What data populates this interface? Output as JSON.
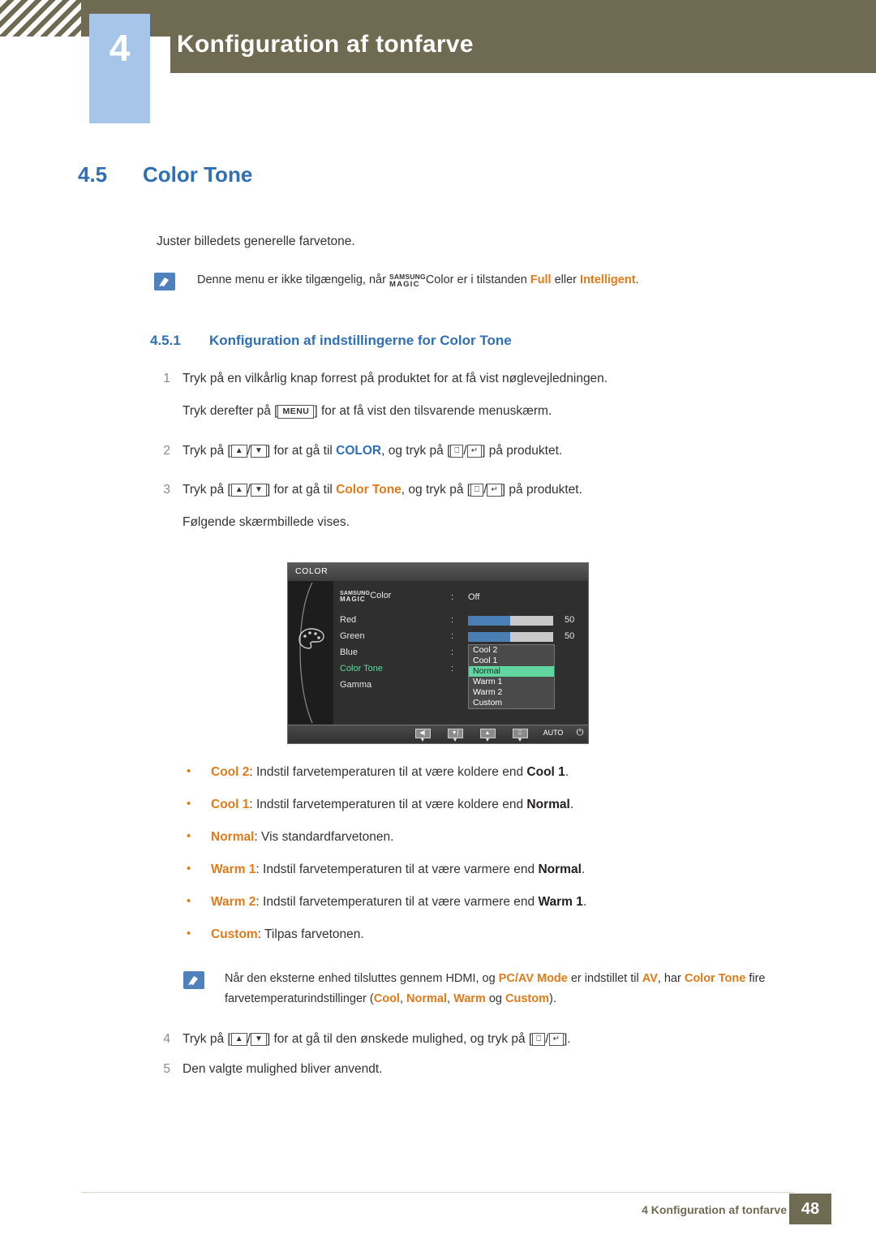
{
  "header": {
    "chapter_number": "4",
    "title": "Konfiguration af tonfarve"
  },
  "section": {
    "number": "4.5",
    "title": "Color Tone",
    "intro": "Juster billedets generelle farvetone."
  },
  "note1": {
    "pre": "Denne menu er ikke tilgængelig, når ",
    "magic_top": "SAMSUNG",
    "magic_bottom": "MAGIC",
    "color_word": "Color",
    "mid": " er i tilstanden ",
    "full": "Full",
    "eller": " eller ",
    "intelligent": "Intelligent",
    "end": "."
  },
  "subsection": {
    "number": "4.5.1",
    "title": "Konfiguration af indstillingerne for Color Tone"
  },
  "steps": [
    {
      "num": "1",
      "text": "Tryk på en vilkårlig knap forrest på produktet for at få vist nøglevejledningen.",
      "sub_pre": "Tryk derefter på [",
      "sub_key": "MENU",
      "sub_post": "] for at få vist den tilsvarende menuskærm."
    },
    {
      "num": "2",
      "pre": "Tryk på [",
      "mid": "] for at gå til ",
      "target": "COLOR",
      "post": ", og tryk på [",
      "end": "] på produktet."
    },
    {
      "num": "3",
      "pre": "Tryk på [",
      "mid": "] for at gå til ",
      "target": "Color Tone",
      "post": ", og tryk på [",
      "end": "] på produktet.",
      "sub": "Følgende skærmbillede vises."
    }
  ],
  "osd": {
    "title": "COLOR",
    "magic_top": "SAMSUNG",
    "magic_bottom": "MAGIC",
    "magic_label": "Color",
    "magic_value": "Off",
    "rows": [
      {
        "name": "Red",
        "value": "50",
        "fill": 50
      },
      {
        "name": "Green",
        "value": "50",
        "fill": 50
      },
      {
        "name": "Blue",
        "value": "",
        "fill": 0
      },
      {
        "name": "Color Tone",
        "value": "",
        "fill": 0
      },
      {
        "name": "Gamma",
        "value": "",
        "fill": 0
      }
    ],
    "dropdown": [
      {
        "label": "Cool 2",
        "selected": false
      },
      {
        "label": "Cool 1",
        "selected": false
      },
      {
        "label": "Normal",
        "selected": true
      },
      {
        "label": "Warm 1",
        "selected": false
      },
      {
        "label": "Warm 2",
        "selected": false
      },
      {
        "label": "Custom",
        "selected": false
      }
    ],
    "bottom_buttons": [
      "back",
      "down",
      "up",
      "enter",
      "AUTO",
      "power"
    ],
    "auto_label": "AUTO"
  },
  "bullets": [
    {
      "term": "Cool 2",
      "pre": ": Indstil farvetemperaturen til at være koldere end ",
      "ref": "Cool 1",
      "post": "."
    },
    {
      "term": "Cool 1",
      "pre": ": Indstil farvetemperaturen til at være koldere end ",
      "ref": "Normal",
      "post": "."
    },
    {
      "term": "Normal",
      "pre": ": Vis standardfarvetonen.",
      "ref": "",
      "post": ""
    },
    {
      "term": "Warm 1",
      "pre": ": Indstil farvetemperaturen til at være varmere end ",
      "ref": "Normal",
      "post": "."
    },
    {
      "term": "Warm 2",
      "pre": ": Indstil farvetemperaturen til at være varmere end ",
      "ref": "Warm 1",
      "post": "."
    },
    {
      "term": "Custom",
      "pre": ": Tilpas farvetonen.",
      "ref": "",
      "post": ""
    }
  ],
  "note2": {
    "l1_pre": "Når den eksterne enhed tilsluttes gennem HDMI, og ",
    "l1_b1": "PC/AV Mode",
    "l1_mid": " er indstillet til ",
    "l1_b2": "AV",
    "l1_post": ", har ",
    "l2_b1": "Color Tone",
    "l2_mid": " fire farvetemperaturindstillinger (",
    "l2_b2": "Cool",
    "l2_sep1": ", ",
    "l2_b3": "Normal",
    "l2_sep2": ", ",
    "l2_b4": "Warm",
    "l2_sep3": " og ",
    "l2_b5": "Custom",
    "l2_end": ")."
  },
  "steps_tail": [
    {
      "num": "4",
      "pre": "Tryk på [",
      "mid": "] for at gå til den ønskede mulighed, og tryk på [",
      "end": "]."
    },
    {
      "num": "5",
      "text": "Den valgte mulighed bliver anvendt."
    }
  ],
  "footer": {
    "text": "4 Konfiguration af tonfarve",
    "page": "48"
  }
}
